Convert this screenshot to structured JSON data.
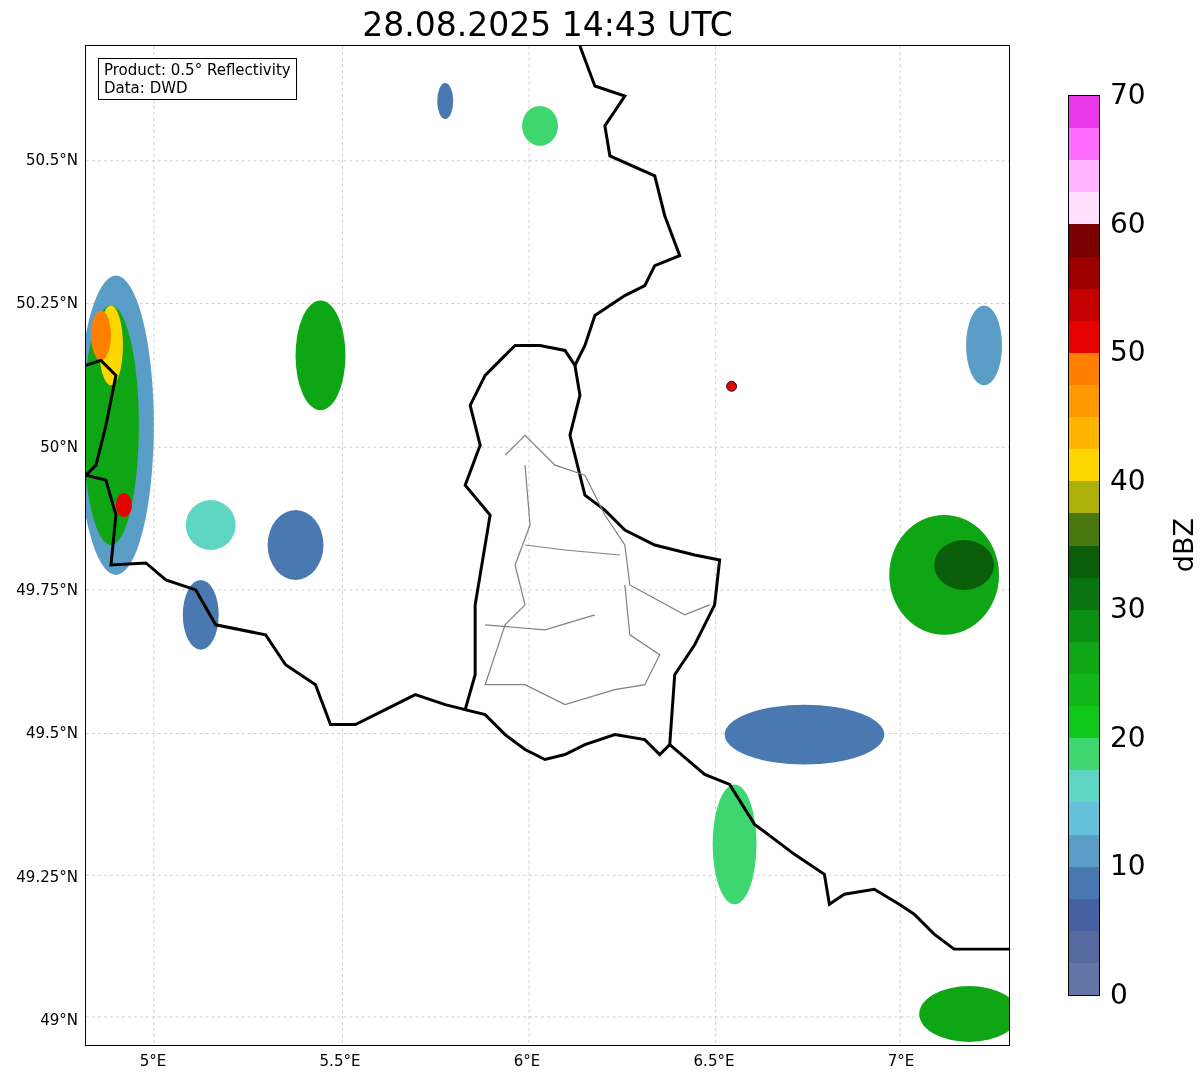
{
  "title": "28.08.2025 14:43 UTC",
  "info_box": [
    "Product: 0.5° Reflectivity",
    "Data: DWD"
  ],
  "y_ticks": [
    "50.5°N",
    "50.25°N",
    "50°N",
    "49.75°N",
    "49.5°N",
    "49.25°N",
    "49°N"
  ],
  "x_ticks": [
    "5°E",
    "5.5°E",
    "6°E",
    "6.5°E",
    "7°E"
  ],
  "colorbar": {
    "label": "dBZ",
    "ticks": [
      "70",
      "60",
      "50",
      "40",
      "30",
      "20",
      "10",
      "0"
    ],
    "segments": [
      {
        "color": "#e838e8"
      },
      {
        "color": "#ff6cff"
      },
      {
        "color": "#ffb4ff"
      },
      {
        "color": "#ffe0ff"
      },
      {
        "color": "#780000"
      },
      {
        "color": "#9e0000"
      },
      {
        "color": "#c40000"
      },
      {
        "color": "#e60000"
      },
      {
        "color": "#ff7f00"
      },
      {
        "color": "#ff9900"
      },
      {
        "color": "#ffb400"
      },
      {
        "color": "#ffd700"
      },
      {
        "color": "#adb007"
      },
      {
        "color": "#48780c"
      },
      {
        "color": "#0a5e0a"
      },
      {
        "color": "#08750e"
      },
      {
        "color": "#0b8f12"
      },
      {
        "color": "#0fa616"
      },
      {
        "color": "#12b81a"
      },
      {
        "color": "#10c81a"
      },
      {
        "color": "#3ed66e"
      },
      {
        "color": "#5fd6c4"
      },
      {
        "color": "#66c1dc"
      },
      {
        "color": "#5a9ec8"
      },
      {
        "color": "#4a78b0"
      },
      {
        "color": "#4560a3"
      },
      {
        "color": "#566aa0"
      },
      {
        "color": "#6476a8"
      }
    ]
  }
}
